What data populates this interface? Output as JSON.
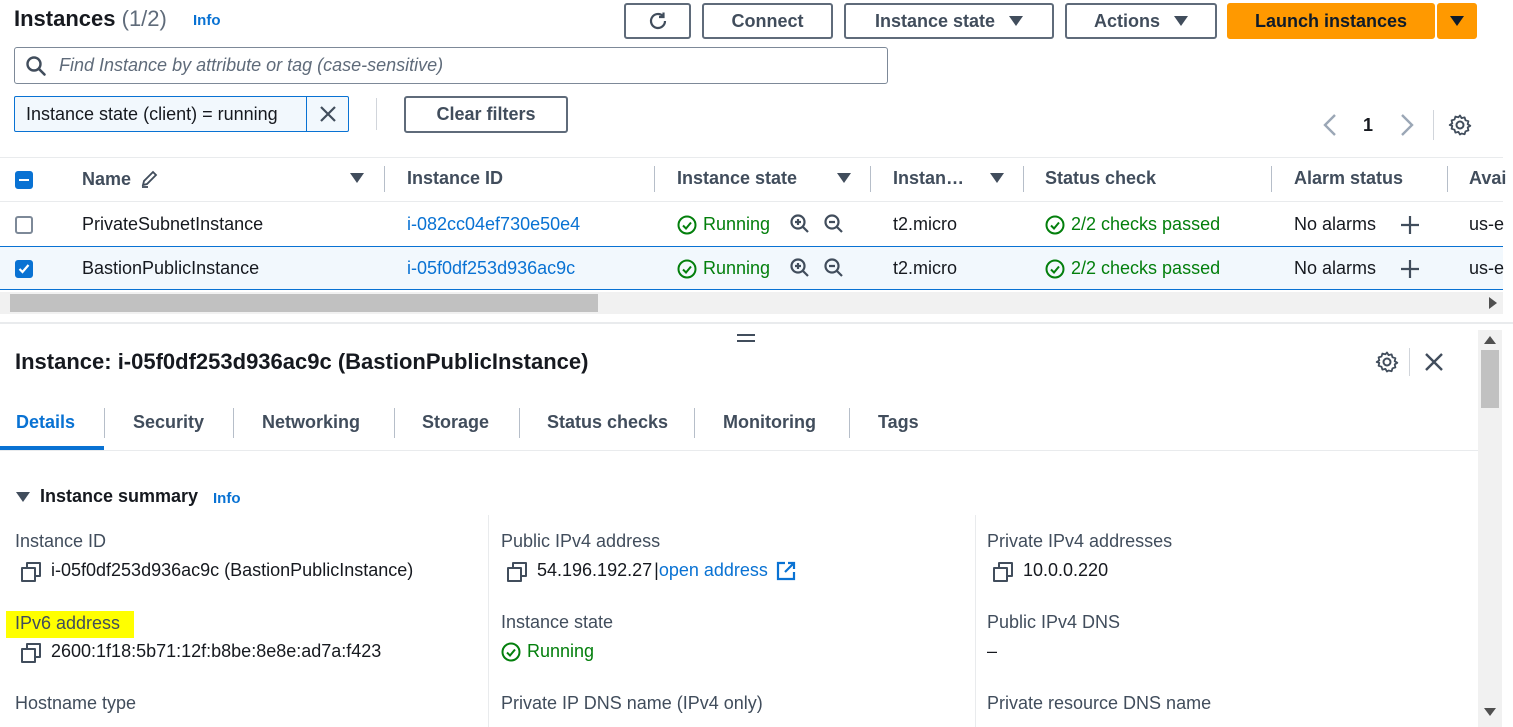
{
  "header": {
    "title": "Instances",
    "count": "(1/2)",
    "info": "Info",
    "buttons": {
      "connect": "Connect",
      "instance_state": "Instance state",
      "actions": "Actions",
      "launch": "Launch instances"
    }
  },
  "search": {
    "placeholder": "Find Instance by attribute or tag (case-sensitive)"
  },
  "filter": {
    "token": "Instance state (client) = running",
    "clear": "Clear filters"
  },
  "pagination": {
    "page": "1"
  },
  "table": {
    "columns": [
      "Name",
      "Instance ID",
      "Instance state",
      "Instan…",
      "Status check",
      "Alarm status",
      "Avai"
    ],
    "rows": [
      {
        "name": "PrivateSubnetInstance",
        "id": "i-082cc04ef730e50e4",
        "state": "Running",
        "type": "t2.micro",
        "status": "2/2 checks passed",
        "alarm": "No alarms",
        "az": "us-e",
        "selected": false
      },
      {
        "name": "BastionPublicInstance",
        "id": "i-05f0df253d936ac9c",
        "state": "Running",
        "type": "t2.micro",
        "status": "2/2 checks passed",
        "alarm": "No alarms",
        "az": "us-e",
        "selected": true
      }
    ]
  },
  "detail": {
    "title": "Instance: i-05f0df253d936ac9c (BastionPublicInstance)",
    "tabs": [
      "Details",
      "Security",
      "Networking",
      "Storage",
      "Status checks",
      "Monitoring",
      "Tags"
    ],
    "summary": {
      "label": "Instance summary",
      "info": "Info"
    },
    "fields": {
      "instance_id_label": "Instance ID",
      "instance_id_value": "i-05f0df253d936ac9c (BastionPublicInstance)",
      "public_ipv4_label": "Public IPv4 address",
      "public_ipv4_value": "54.196.192.27",
      "open_address": "open address",
      "private_ipv4_label": "Private IPv4 addresses",
      "private_ipv4_value": "10.0.0.220",
      "ipv6_label": "IPv6 address",
      "ipv6_value": "2600:1f18:5b71:12f:b8be:8e8e:ad7a:f423",
      "state_label": "Instance state",
      "state_value": "Running",
      "public_dns_label": "Public IPv4 DNS",
      "public_dns_value": "–",
      "hostname_label": "Hostname type",
      "private_dns_label": "Private IP DNS name (IPv4 only)",
      "private_resource_label": "Private resource DNS name"
    }
  },
  "colors": {
    "accent": "#0972d3",
    "launch": "#ff9900",
    "running": "#037f0c",
    "highlight": "#ffff00"
  }
}
